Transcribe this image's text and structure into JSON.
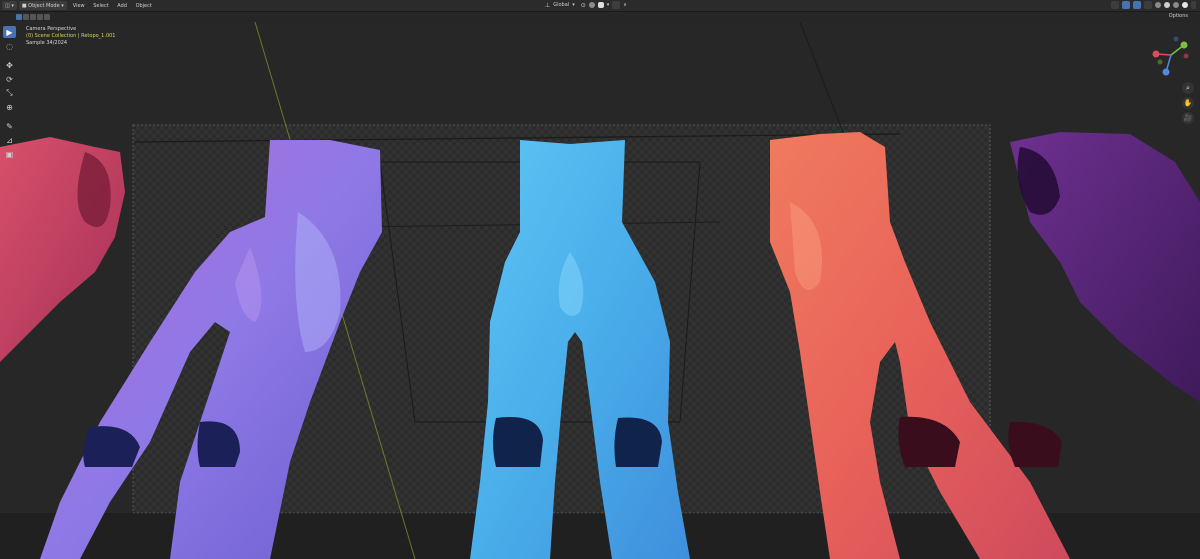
{
  "header": {
    "mode_label": "Object Mode",
    "menu": [
      "View",
      "Select",
      "Add",
      "Object"
    ],
    "transform_orientation": "Global"
  },
  "subheader": {
    "options_label": "Options"
  },
  "overlay": {
    "camera": "Camera Perspective",
    "collection": "(0) Scene Collection | Retopo_1.001",
    "sample": "Sample 34/2024"
  },
  "toolbar": {
    "tools": [
      {
        "name": "select-box",
        "glyph": "▶"
      },
      {
        "name": "cursor",
        "glyph": "◌"
      },
      {
        "name": "move",
        "glyph": "✥"
      },
      {
        "name": "rotate",
        "glyph": "⟳"
      },
      {
        "name": "scale",
        "glyph": "⤡"
      },
      {
        "name": "transform",
        "glyph": "⊕"
      },
      {
        "name": "annotate",
        "glyph": "✎"
      },
      {
        "name": "measure",
        "glyph": "⊿"
      },
      {
        "name": "add-cube",
        "glyph": "▣"
      }
    ]
  },
  "gizmo": {
    "x_label": "X",
    "y_label": "Y",
    "z_label": "Z"
  },
  "nav_buttons": [
    {
      "name": "zoom",
      "glyph": "⌕"
    },
    {
      "name": "pan",
      "glyph": "✋"
    },
    {
      "name": "camera-view",
      "glyph": "🎥"
    }
  ],
  "colors": {
    "accent": "#4772b3",
    "figure_purple": "#8e6bd8",
    "figure_blue": "#4fb6ee",
    "figure_coral": "#e8685e",
    "figure_pink": "#c8425e",
    "figure_violet": "#5a2a78"
  }
}
